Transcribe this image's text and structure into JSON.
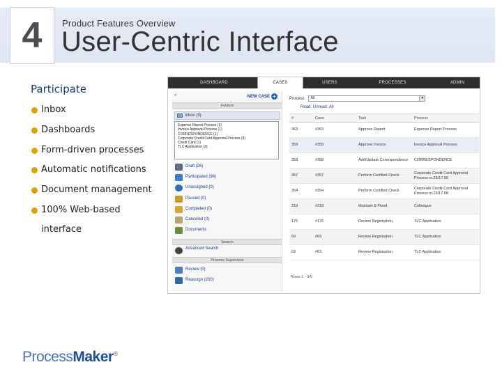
{
  "header": {
    "slide_number": "4",
    "subtitle": "Product Features Overview",
    "title": "User-Centric Interface"
  },
  "left": {
    "heading": "Participate",
    "bullets": [
      "Inbox",
      "Dashboards",
      "Form-driven processes",
      "Automatic notifications",
      "Document management",
      "100% Web-based"
    ],
    "bullet_continuation": "interface",
    "bullet_color": "#e2a100"
  },
  "app": {
    "tabs": [
      "DASHBOARD",
      "CASES",
      "USERS",
      "PROCESSES",
      "ADMIN"
    ],
    "active_tab": "CASES",
    "sidebar": {
      "new_case": "NEW CASE",
      "folders_label": "Folders",
      "inbox_label": "Inbox (9)",
      "popup_lines": [
        "Expense Report Process (1)",
        "Invoice Approval Process (1)",
        "CORRESPONDENCE (1)",
        "Corporate Credit Card Approval Process (3)",
        "Credit Card (1)",
        "TLC Application (2)"
      ],
      "folders": [
        {
          "label": "Draft (26)",
          "icon": "draft-icon",
          "color": "#5a6b82"
        },
        {
          "label": "Participated (96)",
          "icon": "participated-icon",
          "color": "#3c7fc4"
        },
        {
          "label": "Unassigned (0)",
          "icon": "unassigned-icon",
          "color": "#2f6fb3"
        },
        {
          "label": "Paused (0)",
          "icon": "paused-icon",
          "color": "#c59a2d"
        },
        {
          "label": "Completed (0)",
          "icon": "completed-icon",
          "color": "#d4a437"
        },
        {
          "label": "Canceled (0)",
          "icon": "canceled-icon",
          "color": "#b9a46b"
        },
        {
          "label": "Documents",
          "icon": "documents-icon",
          "color": "#6c8c3a"
        }
      ],
      "search_label": "Search",
      "advanced_search": "Advanced Search",
      "process_supervisor_label": "Process Supervisor",
      "supervisor_items": [
        {
          "label": "Review (0)",
          "icon": "review-icon",
          "color": "#4b7fbf"
        },
        {
          "label": "Reassign (200)",
          "icon": "reassign-icon",
          "color": "#2e6aa6"
        }
      ]
    },
    "list": {
      "filter_label": "Process",
      "filter_value": "All",
      "read_links": [
        "Read",
        "Unread",
        "All"
      ],
      "columns": [
        "#",
        "Case",
        "Task",
        "Process"
      ],
      "rows": [
        [
          "363",
          "#363",
          "Approve Report",
          "Expense Report Process"
        ],
        [
          "359",
          "#359",
          "Approve Invoice",
          "Invoice Approval Process"
        ],
        [
          "358",
          "#358",
          "Add/Update Correspondence",
          "CORRESPONDENCE"
        ],
        [
          "357",
          "#357",
          "Perform Certified Check",
          "Corporate Credit Card Approval Process nr.25/17.08"
        ],
        [
          "354",
          "#354",
          "Perform Certified Check",
          "Corporate Credit Card Approval Process nr.25/17.08"
        ],
        [
          "218",
          "#218",
          "Maintain & Flood",
          "Colleague"
        ],
        [
          "176",
          "#176",
          "Review Registration",
          "TLC Application"
        ],
        [
          "69",
          "#69",
          "Review Registration",
          "TLC Application"
        ],
        [
          "63",
          "#63",
          "Review Registration",
          "TLC Application"
        ]
      ],
      "footer": "Rows 1 - 9/9"
    }
  },
  "logo": {
    "part1": "Process",
    "part2": "Maker",
    "mark": "®"
  }
}
